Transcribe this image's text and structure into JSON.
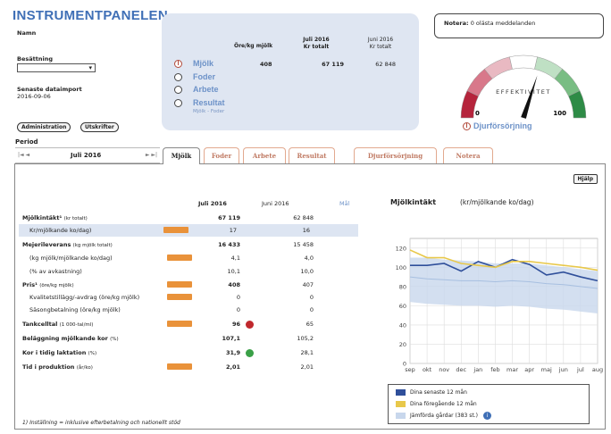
{
  "header": {
    "title": "INSTRUMENTPANELEN",
    "name_label": "Namn",
    "owner_label": "Besättning",
    "owner_value": "",
    "import_label": "Senaste dataimport",
    "import_date": "2016-09-06",
    "admin_button": "Administration",
    "print_button": "Utskrifter",
    "period_label": "Period",
    "period_value": "Juli 2016",
    "period_prev": "|◄ ◄",
    "period_next": "► ►|"
  },
  "summary": {
    "col1": "Öre/kg mjölk",
    "col2_title": "Juli 2016",
    "col2_sub": "Kr totalt",
    "col3_title": "Juni 2016",
    "col3_sub": "Kr totalt",
    "options": [
      {
        "label": "Mjölk",
        "v1": "408",
        "v2": "67 119",
        "v3": "62 848"
      },
      {
        "label": "Foder"
      },
      {
        "label": "Arbete"
      },
      {
        "label": "Resultat",
        "sub": "Mjölk - Foder"
      }
    ]
  },
  "notes": {
    "label": "Notera:",
    "text": "0 olästa meddelanden"
  },
  "gauge": {
    "title": "EFFEKTIVITET",
    "min": "0",
    "max": "100",
    "caption": "Djurförsörjning",
    "value": 60,
    "colors": [
      "#b5243c",
      "#d8788a",
      "#e9b9c2",
      "#fff",
      "#bfe0c4",
      "#79bd83",
      "#2e8b46"
    ]
  },
  "tabs": [
    "Mjölk",
    "Foder",
    "Arbete",
    "Resultat",
    "Djurförsörjning",
    "Notera"
  ],
  "help_button": "Hjälp",
  "table": {
    "col1": "Juli 2016",
    "col2": "Juni 2016",
    "mal": "Mål",
    "rows": [
      {
        "k": "Mjölkintäkt¹",
        "sub": "(kr totalt)",
        "v1": "67 119",
        "v2": "62 848",
        "bold": true
      },
      {
        "k": "Kr/mjölkande ko/dag)",
        "v1": "17",
        "v2": "16",
        "shade": true,
        "badge": true
      },
      {
        "k": "Mejerileverans",
        "sub": "(kg mjölk totalt)",
        "v1": "16 433",
        "v2": "15 458",
        "bold": true
      },
      {
        "k": "(kg mjölk/mjölkande ko/dag)",
        "v1": "4,1",
        "v2": "4,0",
        "badge": true
      },
      {
        "k": "(% av avkastning)",
        "v1": "10,1",
        "v2": "10,0"
      },
      {
        "k": "Pris¹",
        "sub": "(öre/kg mjölk)",
        "v1": "408",
        "v2": "407",
        "bold": true,
        "badge": true
      },
      {
        "k": "Kvalitetstillägg/-avdrag  (öre/kg mjölk)",
        "v1": "0",
        "v2": "0",
        "badge": true
      },
      {
        "k": "Säsongbetalning  (öre/kg mjölk)",
        "v1": "0",
        "v2": "0"
      },
      {
        "k": "Tankcelltal",
        "sub": "(1 000-tal/ml)",
        "v1": "96",
        "v2": "65",
        "bold": true,
        "badge": true,
        "dot": "#c0282d"
      },
      {
        "k": "Beläggning mjölkande kor",
        "sub": "(%)",
        "v1": "107,1",
        "v2": "105,2",
        "bold": true
      },
      {
        "k": "Kor i tidig laktation",
        "sub": "(%)",
        "v1": "31,9",
        "v2": "28,1",
        "bold": true,
        "dot": "#3aa047"
      },
      {
        "k": "Tid i produktion",
        "sub": "(år/ko)",
        "v1": "2,01",
        "v2": "2,01",
        "bold": true,
        "badge": true
      }
    ],
    "footnote": "1) Inställning = inklusive efterbetalning och nationellt stöd"
  },
  "chart_data": {
    "type": "line",
    "title": "Mjölkintäkt",
    "ylabel": "(kr/mjölkande ko/dag)",
    "categories": [
      "sep",
      "okt",
      "nov",
      "dec",
      "jan",
      "feb",
      "mar",
      "apr",
      "maj",
      "jun",
      "jul",
      "aug"
    ],
    "ylim": [
      0,
      130
    ],
    "yticks": [
      0,
      20,
      40,
      60,
      80,
      100,
      120
    ],
    "grid": true,
    "legend": "bottom",
    "series": [
      {
        "name": "Dina senaste 12 mån",
        "color": "#2f4f9a",
        "values": [
          102,
          102,
          104,
          96,
          106,
          100,
          108,
          103,
          92,
          95,
          90,
          86
        ]
      },
      {
        "name": "Dina föregående 12 mån",
        "color": "#e8c84a",
        "values": [
          118,
          110,
          110,
          104,
          102,
          100,
          106,
          106,
          104,
          102,
          100,
          97
        ]
      },
      {
        "name": "Jämförda gårdar (383 st.)",
        "color": "#a7bfe0",
        "values": [
          90,
          88,
          87,
          86,
          86,
          85,
          86,
          85,
          83,
          82,
          80,
          78
        ],
        "band": [
          [
            64,
            110
          ],
          [
            62,
            110
          ],
          [
            61,
            108
          ],
          [
            60,
            107
          ],
          [
            60,
            106
          ],
          [
            59,
            104
          ],
          [
            60,
            104
          ],
          [
            59,
            104
          ],
          [
            57,
            102
          ],
          [
            56,
            100
          ],
          [
            54,
            98
          ],
          [
            52,
            96
          ]
        ]
      }
    ]
  }
}
